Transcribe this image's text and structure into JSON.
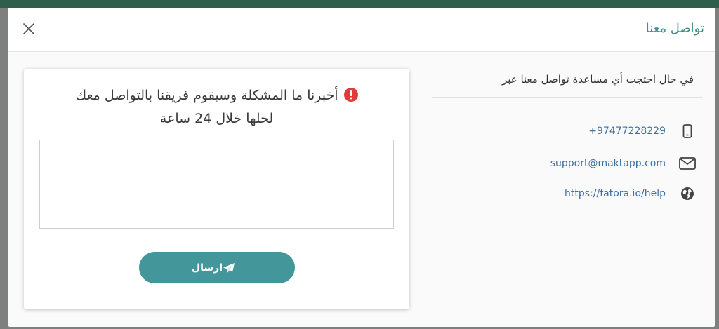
{
  "modal": {
    "title": "تواصل معنا"
  },
  "contact": {
    "intro": "في حال احتجت أي مساعدة تواصل معنا عبر",
    "items": [
      {
        "icon": "mobile-phone-icon",
        "text": "+97477228229"
      },
      {
        "icon": "envelope-icon",
        "text": "support@maktapp.com"
      },
      {
        "icon": "globe-icon",
        "text": "https://fatora.io/help"
      }
    ]
  },
  "form": {
    "heading_line1": "أخبرنا ما المشكلة وسيقوم فريقنا بالتواصل معك",
    "heading_line2": "لحلها خلال 24 ساعة",
    "message_value": "",
    "send_label": "ارسال"
  },
  "colors": {
    "accent": "#43969a",
    "title": "#3f8f8d",
    "link": "#3d6fa5",
    "warning": "#e03b3b"
  }
}
